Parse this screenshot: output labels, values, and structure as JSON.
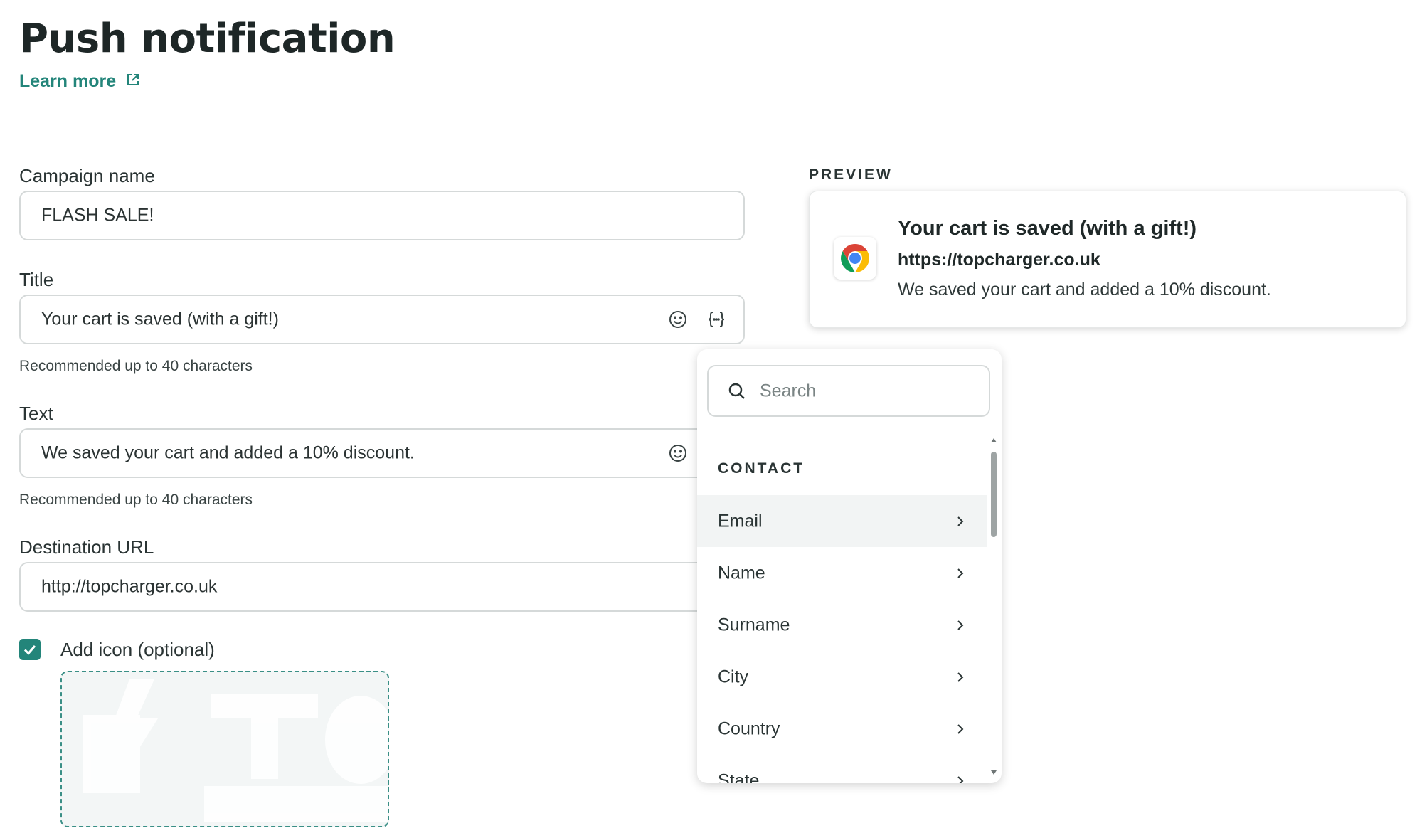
{
  "header": {
    "title": "Push notification",
    "learn_more": "Learn more"
  },
  "form": {
    "campaign_name": {
      "label": "Campaign name",
      "value": "FLASH SALE!"
    },
    "title": {
      "label": "Title",
      "value": "Your cart is saved (with a gift!)",
      "hint": "Recommended up to 40 characters"
    },
    "text": {
      "label": "Text",
      "value": "We saved your cart and added a 10% discount.",
      "hint": "Recommended up to 40 characters"
    },
    "destination_url": {
      "label": "Destination URL",
      "value": "http://topcharger.co.uk"
    },
    "add_icon": {
      "label": "Add icon (optional)",
      "checked": true
    }
  },
  "preview": {
    "label": "PREVIEW",
    "title": "Your cart is saved (with a gift!)",
    "url": "https://topcharger.co.uk",
    "text": "We saved your cart and added a 10% discount."
  },
  "variables_dropdown": {
    "search_placeholder": "Search",
    "section": "CONTACT",
    "items": [
      "Email",
      "Name",
      "Surname",
      "City",
      "Country",
      "State"
    ],
    "active_item": "Email"
  },
  "colors": {
    "accent": "#23857a",
    "text": "#1f2a2a",
    "border": "#d5d9d9"
  },
  "icons": [
    "external-link-icon",
    "emoji-icon",
    "variable-icon",
    "search-icon",
    "chevron-right-icon",
    "checkmark-icon",
    "chrome-icon"
  ]
}
